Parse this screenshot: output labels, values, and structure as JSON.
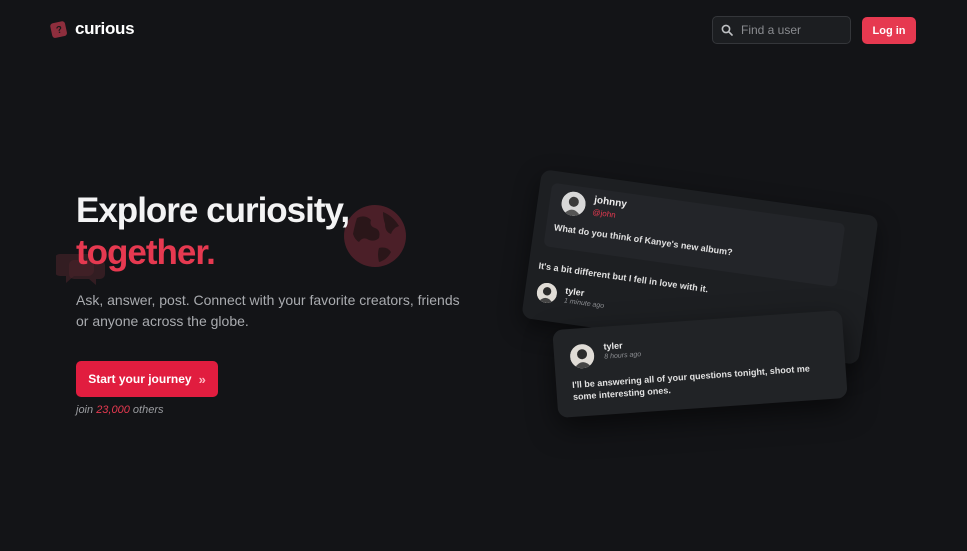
{
  "nav": {
    "logo_text": "curious",
    "search_placeholder": "Find a user",
    "login_label": "Log in"
  },
  "hero": {
    "title_line1": "Explore curiosity,",
    "title_line2": "together.",
    "subtitle": "Ask, answer, post. Connect with your favorite creators, friends or anyone across the globe.",
    "cta_label": "Start your journey",
    "cta_icon": "double-chevron-right-icon",
    "join_prefix": "join",
    "join_count": "23,000",
    "join_suffix": "others"
  },
  "preview": {
    "question": {
      "asker_name": "johnny",
      "asker_handle": "@john",
      "text": "What do you think of Kanye's new album?",
      "answer_text": "It's a bit different but I fell in love with it.",
      "answerer_name": "tyler",
      "answered_ago": "1 minute ago"
    },
    "post": {
      "author_name": "tyler",
      "posted_ago": "8 hours ago",
      "text": "I'll be answering all of your questions tonight, shoot me some interesting ones."
    }
  },
  "colors": {
    "background": "#131417",
    "accent": "#e63950",
    "cta": "#e11d3f"
  }
}
